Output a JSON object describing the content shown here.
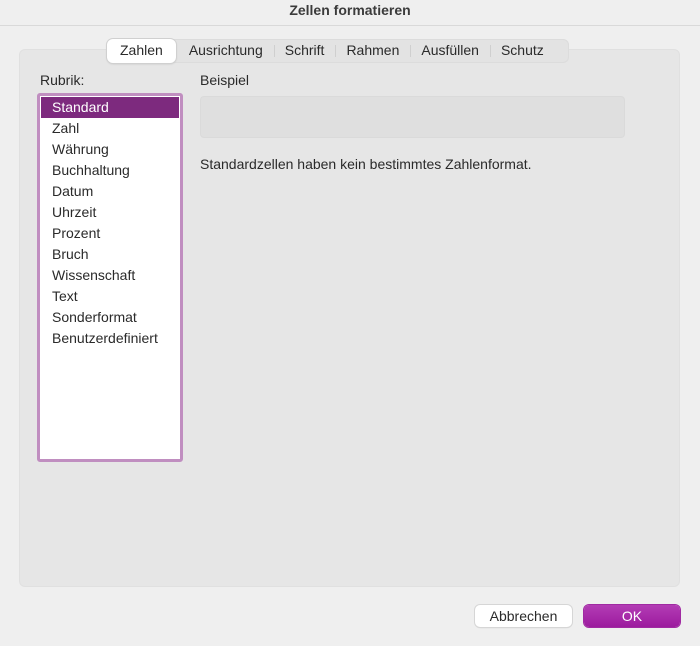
{
  "window": {
    "title": "Zellen formatieren"
  },
  "tabs": [
    {
      "label": "Zahlen",
      "active": true
    },
    {
      "label": "Ausrichtung",
      "active": false
    },
    {
      "label": "Schrift",
      "active": false
    },
    {
      "label": "Rahmen",
      "active": false
    },
    {
      "label": "Ausfüllen",
      "active": false
    },
    {
      "label": "Schutz",
      "active": false
    }
  ],
  "category": {
    "label": "Rubrik:",
    "selected": "Standard",
    "items": [
      "Standard",
      "Zahl",
      "Währung",
      "Buchhaltung",
      "Datum",
      "Uhrzeit",
      "Prozent",
      "Bruch",
      "Wissenschaft",
      "Text",
      "Sonderformat",
      "Benutzerdefiniert"
    ]
  },
  "sample": {
    "label": "Beispiel",
    "value": ""
  },
  "description": "Standardzellen haben kein bestimmtes Zahlenformat.",
  "buttons": {
    "cancel": "Abbrechen",
    "ok": "OK"
  },
  "colors": {
    "accent": "#9c1b9e",
    "selection": "#7d2a7e",
    "list_border": "#c08ec0"
  }
}
